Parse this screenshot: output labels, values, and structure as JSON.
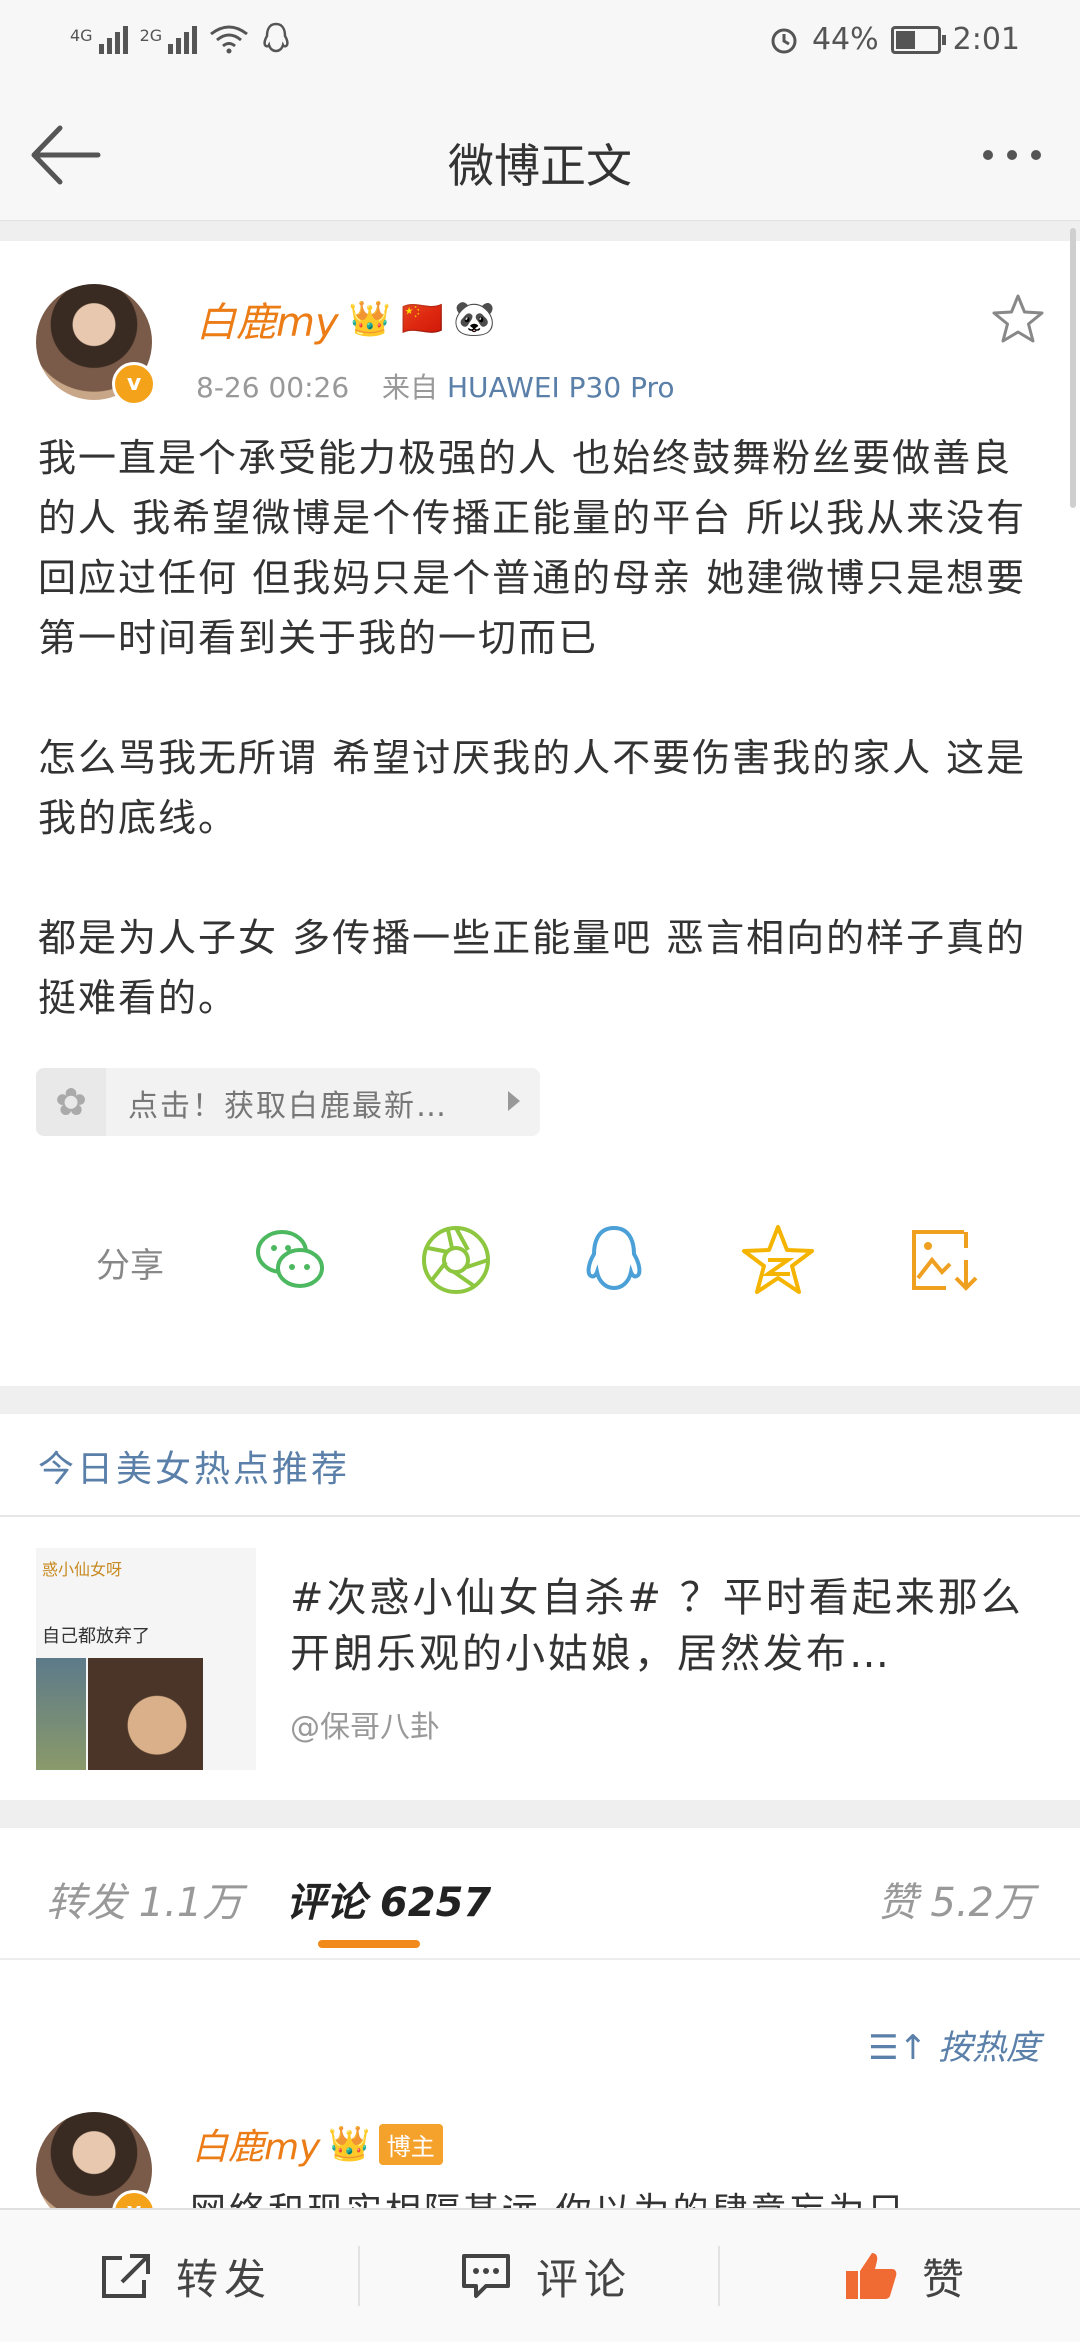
{
  "status_bar": {
    "signal1_label": "4G",
    "signal2_label": "2G",
    "battery_percent": "44%",
    "battery_level": 0.44,
    "time": "2:01"
  },
  "nav": {
    "title": "微博正文"
  },
  "post": {
    "author": "白鹿my",
    "author_emojis": [
      "👑",
      "🇨🇳",
      "🐼"
    ],
    "time": "8-26 00:26",
    "from_label": "来自",
    "source": "HUAWEI P30 Pro",
    "paragraphs": [
      "我一直是个承受能力极强的人 也始终鼓舞粉丝要做善良的人 我希望微博是个传播正能量的平台 所以我从来没有回应过任何 但我妈只是个普通的母亲 她建微博只是想要第一时间看到关于我的一切而已",
      "怎么骂我无所谓 希望讨厌我的人不要伤害我的家人 这是我的底线。",
      "都是为人子女 多传播一些正能量吧 恶言相向的样子真的挺难看的。"
    ],
    "card_text": "点击！获取白鹿最新…"
  },
  "share": {
    "label": "分享",
    "icons": [
      "wechat-icon",
      "moments-icon",
      "qq-icon",
      "qzone-icon",
      "save-image-icon"
    ]
  },
  "recommend": {
    "title": "今日美女热点推荐",
    "text": "#次惑小仙女自杀# ？平时看起来那么开朗乐观的小姑娘，居然发布…",
    "author": "@保哥八卦",
    "thumb_name": "惑小仙女呀",
    "thumb_sub": "自己都放弃了"
  },
  "tabs": {
    "repost": "转发 1.1万",
    "comment": "评论 6257",
    "like": "赞 5.2万"
  },
  "sort_label": "按热度",
  "comment": {
    "author": "白鹿my",
    "badge": "博主",
    "text": "网络和现实相隔甚远 你以为的肆意妄为只"
  },
  "bottom_bar": {
    "repost": "转发",
    "comment": "评论",
    "like": "赞"
  },
  "colors": {
    "accent_orange": "#eb7c16",
    "link_blue": "#5a7fa8",
    "tab_indicator": "#f28a1b"
  }
}
